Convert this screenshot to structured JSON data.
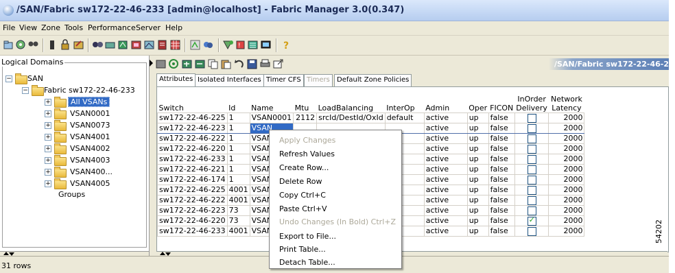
{
  "window": {
    "title": "/SAN/Fabric sw172-22-46-233 [admin@localhost] - Fabric Manager 3.0(0.347)"
  },
  "menu": [
    "File",
    "View",
    "Zone",
    "Tools",
    "Performance",
    "Server",
    "Help"
  ],
  "left_panel": {
    "heading": "Logical Domains",
    "tree": {
      "root": "SAN",
      "fabric": "Fabric sw172-22-46-233",
      "vsans": [
        "All VSANs",
        "VSAN0001",
        "VSAN0073",
        "VSAN4001",
        "VSAN4002",
        "VSAN4003",
        "VSAN400...",
        "VSAN4005"
      ],
      "selected": "All VSANs",
      "groups": "Groups"
    }
  },
  "right_panel": {
    "path_title": "/SAN/Fabric sw172-22-46-2",
    "tabs": [
      {
        "label": "Attributes",
        "state": "active"
      },
      {
        "label": "Isolated Interfaces",
        "state": "normal"
      },
      {
        "label": "Timer CFS",
        "state": "normal"
      },
      {
        "label": "Timers",
        "state": "disabled"
      },
      {
        "label": "Default Zone Policies",
        "state": "normal"
      }
    ],
    "table": {
      "headers": {
        "switch": "Switch",
        "id": "Id",
        "name": "Name",
        "mtu": "Mtu",
        "load_balancing": "LoadBalancing",
        "interop": "InterOp",
        "admin": "Admin",
        "oper": "Oper",
        "ficon": "FICON",
        "inorder_1": "InOrder",
        "inorder_2": "Delivery",
        "latency_1": "Network",
        "latency_2": "Latency"
      },
      "rows": [
        {
          "switch": "sw172-22-46-225",
          "id": "1",
          "name": "VSAN0001",
          "mtu": "2112",
          "lb": "srcId/DestId/OxId",
          "interop": "default",
          "admin": "active",
          "oper": "up",
          "ficon": "false",
          "inorder": false,
          "latency": "2000"
        },
        {
          "switch": "sw172-22-46-223",
          "id": "1",
          "name": "VSAN",
          "mtu": "",
          "lb": "",
          "interop": "",
          "admin": "active",
          "oper": "up",
          "ficon": "false",
          "inorder": false,
          "latency": "2000"
        },
        {
          "switch": "sw172-22-46-222",
          "id": "1",
          "name": "VSAN",
          "mtu": "",
          "lb": "",
          "interop": "",
          "admin": "active",
          "oper": "up",
          "ficon": "false",
          "inorder": false,
          "latency": "2000"
        },
        {
          "switch": "sw172-22-46-220",
          "id": "1",
          "name": "VSAN",
          "mtu": "",
          "lb": "",
          "interop": "",
          "admin": "active",
          "oper": "up",
          "ficon": "false",
          "inorder": false,
          "latency": "2000"
        },
        {
          "switch": "sw172-22-46-233",
          "id": "1",
          "name": "VSAN",
          "mtu": "",
          "lb": "",
          "interop": "",
          "admin": "active",
          "oper": "up",
          "ficon": "false",
          "inorder": false,
          "latency": "2000"
        },
        {
          "switch": "sw172-22-46-221",
          "id": "1",
          "name": "VSAN",
          "mtu": "",
          "lb": "",
          "interop": "",
          "admin": "active",
          "oper": "up",
          "ficon": "false",
          "inorder": false,
          "latency": "2000"
        },
        {
          "switch": "sw172-22-46-174",
          "id": "1",
          "name": "VSAN",
          "mtu": "",
          "lb": "",
          "interop": "",
          "admin": "active",
          "oper": "up",
          "ficon": "false",
          "inorder": false,
          "latency": "2000"
        },
        {
          "switch": "sw172-22-46-225",
          "id": "4001",
          "name": "VSAN",
          "mtu": "",
          "lb": "",
          "interop": "",
          "admin": "active",
          "oper": "up",
          "ficon": "false",
          "inorder": false,
          "latency": "2000"
        },
        {
          "switch": "sw172-22-46-222",
          "id": "4001",
          "name": "VSAN",
          "mtu": "",
          "lb": "",
          "interop": "",
          "admin": "active",
          "oper": "up",
          "ficon": "false",
          "inorder": false,
          "latency": "2000"
        },
        {
          "switch": "sw172-22-46-223",
          "id": "73",
          "name": "VSAN",
          "mtu": "",
          "lb": "",
          "interop": "",
          "admin": "active",
          "oper": "up",
          "ficon": "false",
          "inorder": false,
          "latency": "2000"
        },
        {
          "switch": "sw172-22-46-220",
          "id": "73",
          "name": "VSAN",
          "mtu": "",
          "lb": "",
          "interop": "",
          "admin": "active",
          "oper": "up",
          "ficon": "false",
          "inorder": true,
          "latency": "2000"
        },
        {
          "switch": "sw172-22-46-233",
          "id": "4001",
          "name": "VSAN",
          "mtu": "",
          "lb": "",
          "interop": "",
          "admin": "active",
          "oper": "up",
          "ficon": "false",
          "inorder": false,
          "latency": "2000"
        }
      ]
    }
  },
  "context_menu": [
    {
      "label": "Apply Changes",
      "enabled": false
    },
    {
      "label": "Refresh Values",
      "enabled": true
    },
    {
      "label": "Create Row...",
      "enabled": true
    },
    {
      "label": "Delete Row",
      "enabled": true
    },
    {
      "label": "Copy  Ctrl+C",
      "enabled": true
    },
    {
      "label": "Paste  Ctrl+V",
      "enabled": true
    },
    {
      "label": "Undo Changes (In Bold)  Ctrl+Z",
      "enabled": false
    },
    {
      "label": "Export to File...",
      "enabled": true
    },
    {
      "label": "Print Table...",
      "enabled": true
    },
    {
      "label": "Detach Table...",
      "enabled": true
    }
  ],
  "status": {
    "rows_text": "31 rows"
  },
  "figure_id": "54202"
}
